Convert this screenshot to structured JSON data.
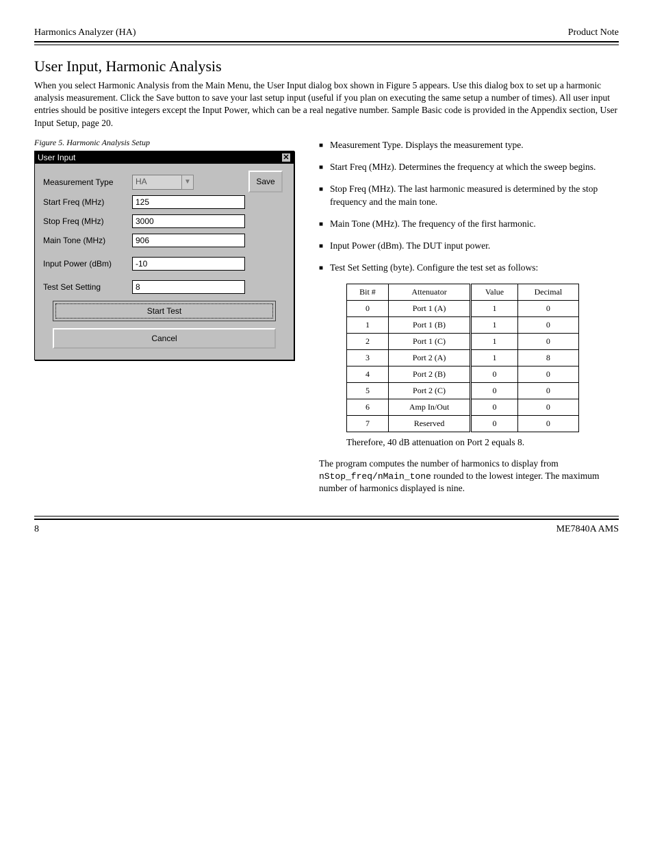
{
  "header": {
    "left": "Harmonics Analyzer (HA)",
    "right": "Product Note"
  },
  "section_title": "User Input, Harmonic Analysis",
  "intro_para": "When you select Harmonic Analysis from the Main Menu, the User Input dialog box shown in Figure 5 appears. Use this dialog box to set up a harmonic analysis measurement. Click the Save button to save your last setup input (useful if you plan on executing the same setup a number of times). All user input entries should be positive integers except the Input Power, which can be a real negative number. Sample Basic code is provided in the Appendix section, User Input Setup, page 20.",
  "fig_caption": "Figure 5.  Harmonic Analysis Setup",
  "dialog": {
    "title": "User Input",
    "fields": {
      "measurement_type_label": "Measurement Type",
      "measurement_type_value": "HA",
      "start_freq_label": "Start Freq (MHz)",
      "start_freq_value": "125",
      "stop_freq_label": "Stop Freq (MHz)",
      "stop_freq_value": "3000",
      "main_tone_label": "Main Tone (MHz)",
      "main_tone_value": "906",
      "input_power_label": "Input Power (dBm)",
      "input_power_value": "-10",
      "test_set_label": "Test Set Setting",
      "test_set_value": "8"
    },
    "save_btn": "Save",
    "start_btn": "Start Test",
    "cancel_btn": "Cancel"
  },
  "bullets": {
    "b0": "Measurement Type. Displays the measurement type.",
    "b1": "Start Freq (MHz). Determines the frequency at which the sweep begins.",
    "b2": "Stop Freq (MHz). The last harmonic measured is determined by the stop frequency and the main tone.",
    "b3": "Main Tone (MHz). The frequency of the first harmonic.",
    "b4": "Input Power (dBm). The DUT input power.",
    "b5": "Test Set Setting (byte). Configure the test set as follows:"
  },
  "table": {
    "headers": {
      "h0": "Bit #",
      "h1": "Attenuator",
      "h2": "Value",
      "h3": "Decimal"
    },
    "rows": [
      {
        "c0": "0",
        "c1": "Port 1 (A)",
        "c2": "1",
        "c3": "0"
      },
      {
        "c0": "1",
        "c1": "Port 1 (B)",
        "c2": "1",
        "c3": "0"
      },
      {
        "c0": "2",
        "c1": "Port 1 (C)",
        "c2": "1",
        "c3": "0"
      },
      {
        "c0": "3",
        "c1": "Port 2 (A)",
        "c2": "1",
        "c3": "8"
      },
      {
        "c0": "4",
        "c1": "Port 2 (B)",
        "c2": "0",
        "c3": "0"
      },
      {
        "c0": "5",
        "c1": "Port 2 (C)",
        "c2": "0",
        "c3": "0"
      },
      {
        "c0": "6",
        "c1": "Amp In/Out",
        "c2": "0",
        "c3": "0"
      },
      {
        "c0": "7",
        "c1": "Reserved",
        "c2": "0",
        "c3": "0"
      }
    ]
  },
  "under_table_text": "Therefore, 40 dB attenuation on Port 2 equals 8.",
  "below_text_html": "The program computes the number of harmonics to display from <span class='mono'>nStop_freq/nMain_tone</span> rounded to the lowest integer. The maximum number of harmonics displayed is nine.",
  "footer": {
    "page": "8",
    "right": "ME7840A AMS"
  }
}
